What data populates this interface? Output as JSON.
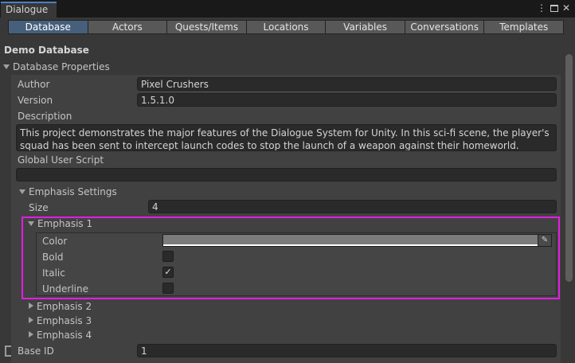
{
  "window": {
    "tab_title": "Dialogue"
  },
  "tabs": [
    "Database",
    "Actors",
    "Quests/Items",
    "Locations",
    "Variables",
    "Conversations",
    "Templates"
  ],
  "active_tab": "Database",
  "database": {
    "name": "Demo Database",
    "properties_label": "Database Properties",
    "author_label": "Author",
    "author_value": "Pixel Crushers",
    "version_label": "Version",
    "version_value": "1.5.1.0",
    "description_label": "Description",
    "description_value": "This project demonstrates the major features of the Dialogue System for Unity.  In this sci-fi scene, the player's squad has been sent to intercept launch codes to stop the launch of a weapon against their homeworld.",
    "global_user_script_label": "Global User Script",
    "global_user_script_value": "",
    "emphasis_settings_label": "Emphasis Settings",
    "size_label": "Size",
    "size_value": "4",
    "emphasis_1": {
      "label": "Emphasis 1",
      "color_label": "Color",
      "color_value": "#7b7b7b",
      "bold_label": "Bold",
      "bold": false,
      "italic_label": "Italic",
      "italic": true,
      "underline_label": "Underline",
      "underline": false
    },
    "emphasis_2_label": "Emphasis 2",
    "emphasis_3_label": "Emphasis 3",
    "emphasis_4_label": "Emphasis 4",
    "base_id_label": "Base ID",
    "base_id_value": "1"
  },
  "colors": {
    "highlight": "#e21ee2",
    "active_tab": "#46607c",
    "panel": "#383838"
  },
  "icons": {
    "check": "✓",
    "kebab": "⋮",
    "eyedropper": "✎"
  }
}
